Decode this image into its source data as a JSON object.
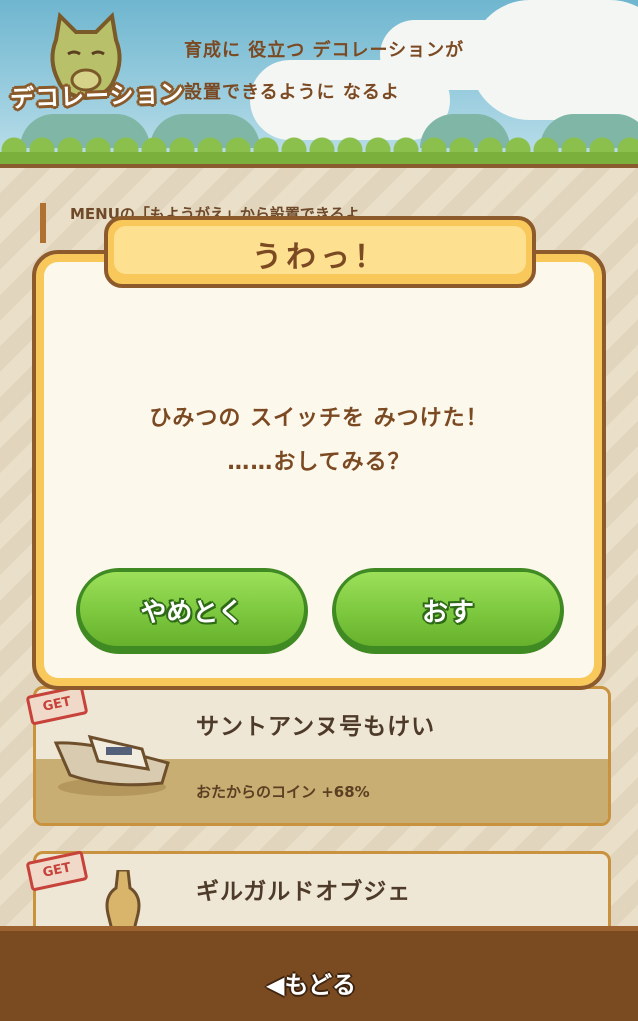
{
  "header": {
    "badge": "デコレーション",
    "description_line1": "育成に 役立つ デコレーションが",
    "description_line2": "設置できるように なるよ"
  },
  "hint": "MENUの「もようがえ」から設置できるよ",
  "items": [
    {
      "tag": "GET",
      "name": "サントアンヌ号もけい",
      "effect": "おたからのコイン +68%"
    },
    {
      "tag": "GET",
      "name": "ギルガルドオブジェ"
    }
  ],
  "dialog": {
    "title": "うわっ！",
    "line1": "ひみつの スイッチを みつけた！",
    "line2": "……おしてみる？",
    "cancel_label": "やめとく",
    "confirm_label": "おす"
  },
  "footer": {
    "back_label": "もどる"
  },
  "colors": {
    "button_green": "#7cc83e",
    "brown_text": "#7b4a23",
    "dialog_border": "#8d5a2b",
    "title_yellow": "#f8c85a"
  }
}
